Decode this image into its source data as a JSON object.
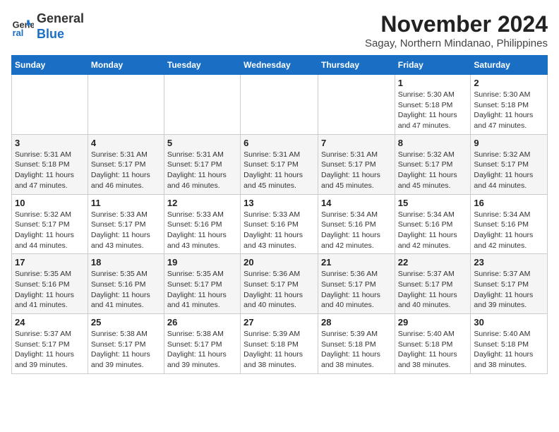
{
  "logo": {
    "line1": "General",
    "line2": "Blue"
  },
  "title": "November 2024",
  "subtitle": "Sagay, Northern Mindanao, Philippines",
  "days_of_week": [
    "Sunday",
    "Monday",
    "Tuesday",
    "Wednesday",
    "Thursday",
    "Friday",
    "Saturday"
  ],
  "weeks": [
    [
      {
        "day": "",
        "info": ""
      },
      {
        "day": "",
        "info": ""
      },
      {
        "day": "",
        "info": ""
      },
      {
        "day": "",
        "info": ""
      },
      {
        "day": "",
        "info": ""
      },
      {
        "day": "1",
        "info": "Sunrise: 5:30 AM\nSunset: 5:18 PM\nDaylight: 11 hours and 47 minutes."
      },
      {
        "day": "2",
        "info": "Sunrise: 5:30 AM\nSunset: 5:18 PM\nDaylight: 11 hours and 47 minutes."
      }
    ],
    [
      {
        "day": "3",
        "info": "Sunrise: 5:31 AM\nSunset: 5:18 PM\nDaylight: 11 hours and 47 minutes."
      },
      {
        "day": "4",
        "info": "Sunrise: 5:31 AM\nSunset: 5:17 PM\nDaylight: 11 hours and 46 minutes."
      },
      {
        "day": "5",
        "info": "Sunrise: 5:31 AM\nSunset: 5:17 PM\nDaylight: 11 hours and 46 minutes."
      },
      {
        "day": "6",
        "info": "Sunrise: 5:31 AM\nSunset: 5:17 PM\nDaylight: 11 hours and 45 minutes."
      },
      {
        "day": "7",
        "info": "Sunrise: 5:31 AM\nSunset: 5:17 PM\nDaylight: 11 hours and 45 minutes."
      },
      {
        "day": "8",
        "info": "Sunrise: 5:32 AM\nSunset: 5:17 PM\nDaylight: 11 hours and 45 minutes."
      },
      {
        "day": "9",
        "info": "Sunrise: 5:32 AM\nSunset: 5:17 PM\nDaylight: 11 hours and 44 minutes."
      }
    ],
    [
      {
        "day": "10",
        "info": "Sunrise: 5:32 AM\nSunset: 5:17 PM\nDaylight: 11 hours and 44 minutes."
      },
      {
        "day": "11",
        "info": "Sunrise: 5:33 AM\nSunset: 5:17 PM\nDaylight: 11 hours and 43 minutes."
      },
      {
        "day": "12",
        "info": "Sunrise: 5:33 AM\nSunset: 5:16 PM\nDaylight: 11 hours and 43 minutes."
      },
      {
        "day": "13",
        "info": "Sunrise: 5:33 AM\nSunset: 5:16 PM\nDaylight: 11 hours and 43 minutes."
      },
      {
        "day": "14",
        "info": "Sunrise: 5:34 AM\nSunset: 5:16 PM\nDaylight: 11 hours and 42 minutes."
      },
      {
        "day": "15",
        "info": "Sunrise: 5:34 AM\nSunset: 5:16 PM\nDaylight: 11 hours and 42 minutes."
      },
      {
        "day": "16",
        "info": "Sunrise: 5:34 AM\nSunset: 5:16 PM\nDaylight: 11 hours and 42 minutes."
      }
    ],
    [
      {
        "day": "17",
        "info": "Sunrise: 5:35 AM\nSunset: 5:16 PM\nDaylight: 11 hours and 41 minutes."
      },
      {
        "day": "18",
        "info": "Sunrise: 5:35 AM\nSunset: 5:16 PM\nDaylight: 11 hours and 41 minutes."
      },
      {
        "day": "19",
        "info": "Sunrise: 5:35 AM\nSunset: 5:17 PM\nDaylight: 11 hours and 41 minutes."
      },
      {
        "day": "20",
        "info": "Sunrise: 5:36 AM\nSunset: 5:17 PM\nDaylight: 11 hours and 40 minutes."
      },
      {
        "day": "21",
        "info": "Sunrise: 5:36 AM\nSunset: 5:17 PM\nDaylight: 11 hours and 40 minutes."
      },
      {
        "day": "22",
        "info": "Sunrise: 5:37 AM\nSunset: 5:17 PM\nDaylight: 11 hours and 40 minutes."
      },
      {
        "day": "23",
        "info": "Sunrise: 5:37 AM\nSunset: 5:17 PM\nDaylight: 11 hours and 39 minutes."
      }
    ],
    [
      {
        "day": "24",
        "info": "Sunrise: 5:37 AM\nSunset: 5:17 PM\nDaylight: 11 hours and 39 minutes."
      },
      {
        "day": "25",
        "info": "Sunrise: 5:38 AM\nSunset: 5:17 PM\nDaylight: 11 hours and 39 minutes."
      },
      {
        "day": "26",
        "info": "Sunrise: 5:38 AM\nSunset: 5:17 PM\nDaylight: 11 hours and 39 minutes."
      },
      {
        "day": "27",
        "info": "Sunrise: 5:39 AM\nSunset: 5:18 PM\nDaylight: 11 hours and 38 minutes."
      },
      {
        "day": "28",
        "info": "Sunrise: 5:39 AM\nSunset: 5:18 PM\nDaylight: 11 hours and 38 minutes."
      },
      {
        "day": "29",
        "info": "Sunrise: 5:40 AM\nSunset: 5:18 PM\nDaylight: 11 hours and 38 minutes."
      },
      {
        "day": "30",
        "info": "Sunrise: 5:40 AM\nSunset: 5:18 PM\nDaylight: 11 hours and 38 minutes."
      }
    ]
  ]
}
